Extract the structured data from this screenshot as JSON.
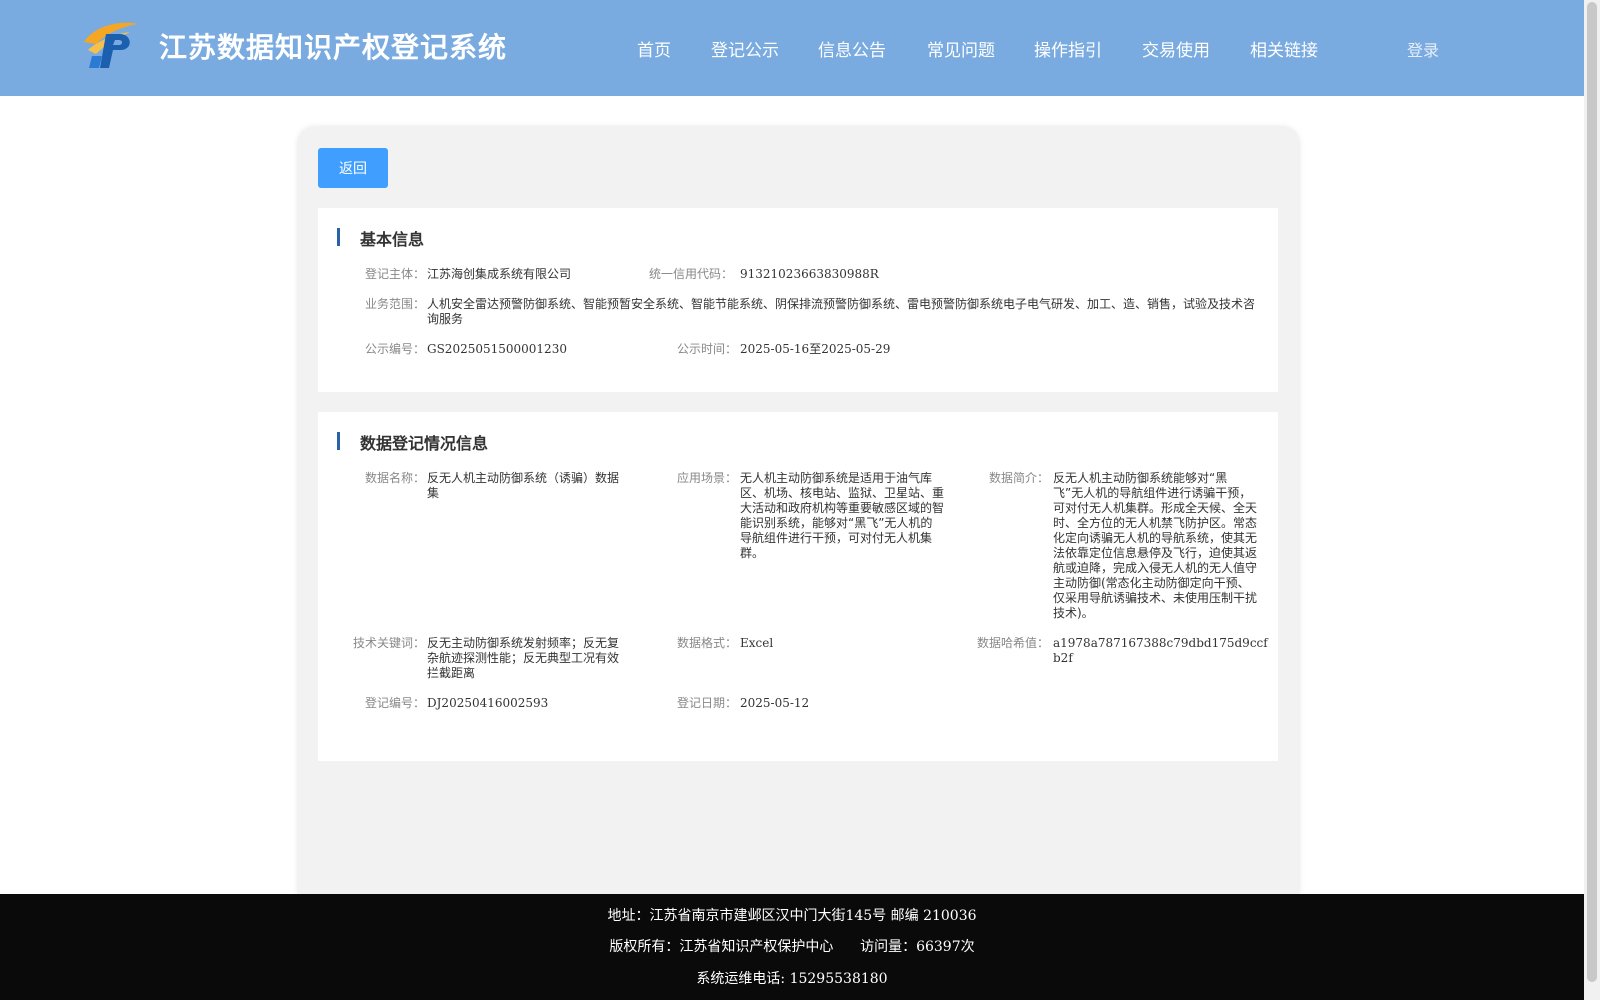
{
  "header": {
    "title": "江苏数据知识产权登记系统",
    "logo": {
      "icon": "ip-logo-icon",
      "colors": [
        "#f5a623",
        "#1b5fae"
      ]
    },
    "nav": [
      "首页",
      "登记公示",
      "信息公告",
      "常见问题",
      "操作指引",
      "交易使用",
      "相关链接"
    ],
    "login_label": "登录"
  },
  "back_label": "返回",
  "basic_info": {
    "title": "基本信息",
    "entity_label": "登记主体：",
    "entity_value": "江苏海创集成系统有限公司",
    "credit_code_label": "统一信用代码：",
    "credit_code_value": "91321023663830988R",
    "scope_label": "业务范围：",
    "scope_value": "人机安全雷达预警防御系统、智能预暂安全系统、智能节能系统、阴保排流预警防御系统、雷电预警防御系统电子电气研发、加工、造、销售，试验及技术咨询服务",
    "notice_no_label": "公示编号：",
    "notice_no_value": "GS2025051500001230",
    "notice_time_label": "公示时间：",
    "notice_time_value": "2025-05-16至2025-05-29"
  },
  "registration_info": {
    "title": "数据登记情况信息",
    "data_name_label": "数据名称：",
    "data_name_value": "反无人机主动防御系统（诱骗）数据集",
    "scene_label": "应用场景：",
    "scene_value": "无人机主动防御系统是适用于油气库区、机场、核电站、监狱、卫星站、重大活动和政府机构等重要敏感区域的智能识别系统，能够对“黑飞”无人机的导航组件进行干预，可对付无人机集群。",
    "intro_label": "数据简介：",
    "intro_value": "反无人机主动防御系统能够对“黑飞”无人机的导航组件进行诱骗干预，可对付无人机集群。形成全天候、全天时、全方位的无人机禁飞防护区。常态化定向诱骗无人机的导航系统，使其无法依靠定位信息悬停及飞行，迫使其返航或迫降，完成入侵无人机的无人值守主动防御(常态化主动防御定向干预、仅采用导航诱骗技术、未使用压制干扰技术)。",
    "keywords_label": "技术关键词：",
    "keywords_value": "反无主动防御系统发射频率；反无复杂航迹探测性能；反无典型工况有效拦截距离",
    "format_label": "数据格式：",
    "format_value": "Excel",
    "hash_label": "数据哈希值：",
    "hash_value": "a1978a787167388c79dbd175d9ccfb2f",
    "reg_no_label": "登记编号：",
    "reg_no_value": "DJ20250416002593",
    "reg_date_label": "登记日期：",
    "reg_date_value": "2025-05-12"
  },
  "footer": {
    "address": "地址：江苏省南京市建邺区汉中门大街145号 邮编 210036",
    "copyright": "版权所有：江苏省知识产权保护中心",
    "visits": "访问量：66397次",
    "phone": "系统运维电话: 15295538180"
  },
  "colors": {
    "header_bg": "#7aabe0",
    "primary_button": "#409eff",
    "section_bar": "#2a62a8",
    "footer_bg": "#0a0a0a"
  }
}
